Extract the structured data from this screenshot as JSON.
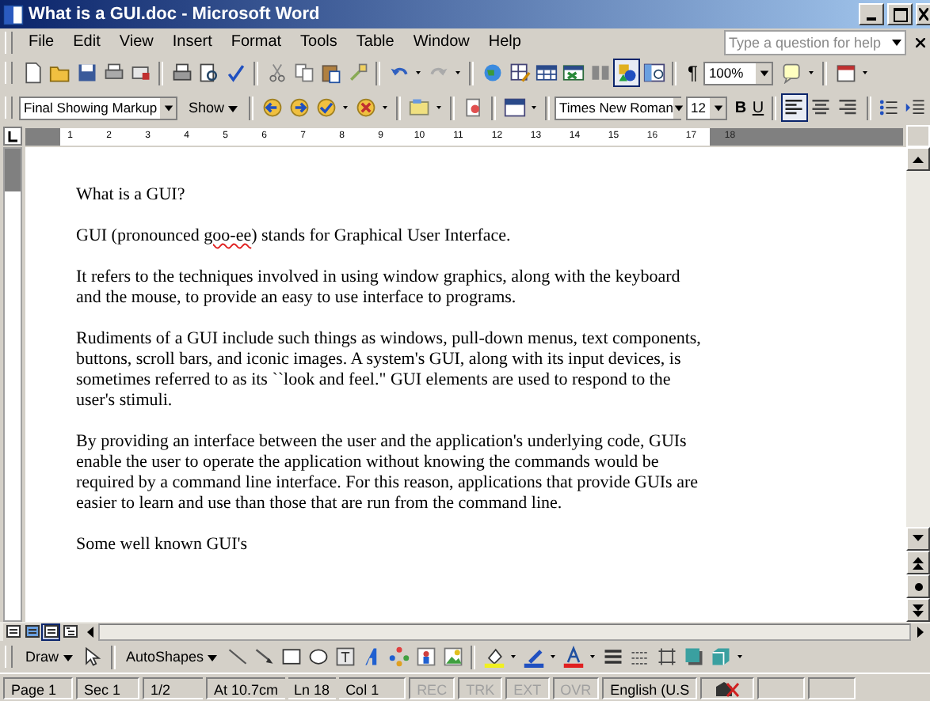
{
  "window": {
    "title": "What is a GUI.doc - Microsoft Word"
  },
  "menu": [
    "File",
    "Edit",
    "View",
    "Insert",
    "Format",
    "Tools",
    "Table",
    "Window",
    "Help"
  ],
  "help": {
    "placeholder": "Type a question for help"
  },
  "standard_toolbar": {
    "zoom": "100%",
    "pilcrow": "¶"
  },
  "reviewing_toolbar": {
    "display": "Final Showing Markup",
    "show": "Show"
  },
  "formatting_toolbar": {
    "font": "Times New Roman",
    "size": "12",
    "bold": "B",
    "underline": "U",
    "alignment": [
      {
        "selected": true
      },
      {
        "selected": false
      },
      {
        "selected": false
      }
    ]
  },
  "ruler": {
    "labels": [
      "1",
      "2",
      "3",
      "4",
      "5",
      "6",
      "7",
      "8",
      "9",
      "10",
      "11",
      "12",
      "13",
      "14",
      "15",
      "16",
      "17",
      "18"
    ]
  },
  "document": {
    "paragraphs": [
      {
        "kind": "lines",
        "lines": [
          "What is a GUI?"
        ]
      },
      {
        "kind": "runs",
        "runs": [
          {
            "text": "GUI (pronounced ",
            "misspelled": false
          },
          {
            "text": "goo-ee",
            "misspelled": true
          },
          {
            "text": ") stands for Graphical User Interface.",
            "misspelled": false
          }
        ]
      },
      {
        "kind": "lines",
        "lines": [
          "It refers to the techniques involved in using window graphics, along with the keyboard",
          "and the mouse, to provide an easy to use interface to programs."
        ]
      },
      {
        "kind": "lines",
        "lines": [
          "Rudiments of a GUI include such things as windows, pull-down menus, text components,",
          "buttons, scroll bars, and iconic images.  A system's GUI, along with its input devices, is",
          "sometimes referred to as its ``look and feel.\" GUI elements are used to respond to the",
          "user's stimuli."
        ]
      },
      {
        "kind": "lines",
        "lines": [
          "By providing an interface between the user and the application's underlying code, GUIs",
          "enable the user to operate the application without knowing the commands would be",
          "required by a command line interface. For this reason, applications that provide GUIs are",
          "easier to learn and use than those that are run from the command line."
        ]
      },
      {
        "kind": "lines",
        "lines": [
          "Some well known GUI's"
        ]
      }
    ]
  },
  "views": [
    {
      "selected": false
    },
    {
      "selected": false
    },
    {
      "selected": true
    },
    {
      "selected": false
    }
  ],
  "drawing_toolbar": {
    "draw": "Draw",
    "autoshapes": "AutoShapes"
  },
  "status_bar": [
    {
      "text": "Page 1",
      "disabled": false
    },
    {
      "text": "Sec 1",
      "disabled": false
    },
    {
      "text": "1/2",
      "disabled": false
    },
    {
      "text": "At 10.7cm",
      "disabled": false
    },
    {
      "text": "Ln 18",
      "disabled": false
    },
    {
      "text": "Col 1",
      "disabled": false
    },
    {
      "text": "REC",
      "disabled": true
    },
    {
      "text": "TRK",
      "disabled": true
    },
    {
      "text": "EXT",
      "disabled": true
    },
    {
      "text": "OVR",
      "disabled": true
    },
    {
      "text": "English (U.S",
      "disabled": false
    }
  ]
}
